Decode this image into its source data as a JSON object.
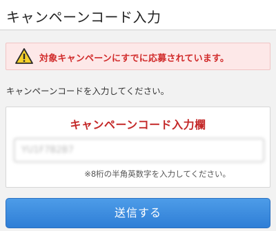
{
  "header": {
    "title": "キャンペーンコード入力"
  },
  "alert": {
    "icon": "warning-icon",
    "message": "対象キャンペーンにすでに応募されています。",
    "color": "#d12a2a"
  },
  "instruction": "キャンペーンコードを入力してください。",
  "form": {
    "title": "キャンペーンコード入力欄",
    "code_value": "YU1F7B2B7",
    "note": "※8桁の半角英数字を入力してください。"
  },
  "submit": {
    "label": "送信する",
    "color": "#3a8ae0"
  }
}
